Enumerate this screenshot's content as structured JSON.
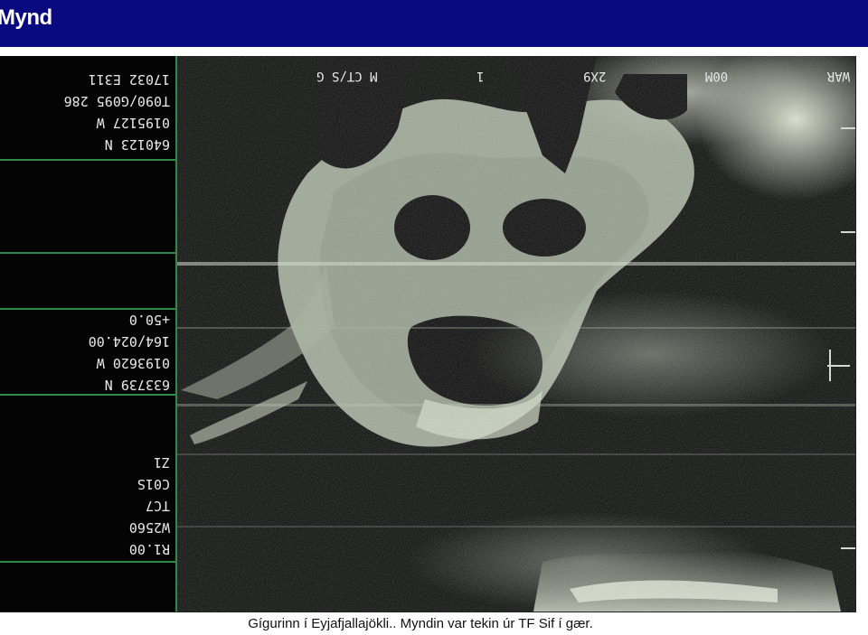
{
  "header": {
    "title": "Mynd"
  },
  "image": {
    "description_icon": "volcano-crater-thermal-icon",
    "left_panel_blocks": [
      [
        "17032 E311",
        "T090/G095 286",
        "0195127 W",
        "640123 N"
      ],
      [
        "+50.0",
        "164/024.00",
        "0193620 W",
        "633739 N"
      ],
      [
        "Z1",
        "C01S",
        "TC7",
        "W2560",
        "R1.00"
      ]
    ],
    "top_hud": [
      "M  CT/S  G",
      "1",
      "2X9",
      "00M",
      "WAR"
    ]
  },
  "caption": {
    "text": "Gígurinn í Eyjafjallajökli.. Myndin var tekin úr TF Sif í gær."
  },
  "colors": {
    "header": "#0a0a80",
    "hud_green": "#2f8a4a",
    "hud_text": "#e8e8e8"
  }
}
